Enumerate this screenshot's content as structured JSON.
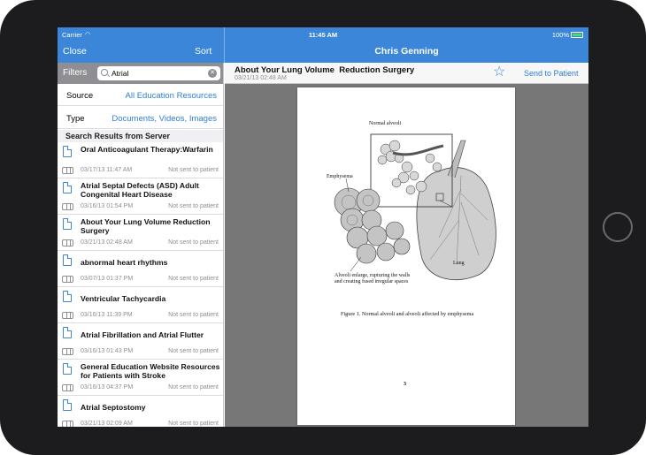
{
  "status_bar": {
    "carrier": "Carrier",
    "time": "11:45 AM",
    "battery": "100%"
  },
  "nav": {
    "close_label": "Close",
    "sort_label": "Sort",
    "title": "Chris Genning"
  },
  "sidebar": {
    "filters_label": "Filters",
    "search": {
      "value": "Atrial",
      "placeholder": ""
    },
    "source_label": "Source",
    "source_value": "All Education Resources",
    "type_label": "Type",
    "type_value": "Documents, Videos, Images",
    "results_header": "Search Results from Server",
    "results": [
      {
        "title": "Oral Anticoagulant Therapy:Warfarin",
        "date": "03/17/13 11:47 AM",
        "status": "Not sent to patient"
      },
      {
        "title": "Atrial Septal Defects (ASD) Adult Congenital Heart Disease",
        "date": "03/16/13 01:54 PM",
        "status": "Not sent to patient"
      },
      {
        "title": "About Your Lung Volume Reduction Surgery",
        "date": "03/21/13 02:48 AM",
        "status": "Not sent to patient"
      },
      {
        "title": "abnormal heart rhythms",
        "date": "03/07/13 01:37 PM",
        "status": "Not sent to patient"
      },
      {
        "title": "Ventricular Tachycardia",
        "date": "03/16/13 11:39 PM",
        "status": "Not sent to patient"
      },
      {
        "title": "Atrial Fibrillation and Atrial Flutter",
        "date": "03/16/13 01:43 PM",
        "status": "Not sent to patient"
      },
      {
        "title": "General Education Website Resources for Patients with Stroke",
        "date": "03/16/13 04:37 PM",
        "status": "Not sent to patient"
      },
      {
        "title": "Atrial Septostomy",
        "date": "03/21/13 02:09 AM",
        "status": "Not sent to patient"
      }
    ]
  },
  "detail": {
    "doc_title": "About Your Lung Volume  Reduction Surgery",
    "doc_date": "03/21/13 02:48 AM",
    "send_label": "Send to Patient",
    "page": {
      "label_normal": "Normal alveoli",
      "label_emphysema": "Emphysema",
      "label_lung": "Lung",
      "label_alveoli": "Alveoli enlarge, rupturing the walls and creating fused irregular spaces",
      "caption": "Figure 1.  Normal alveoli and alveoli affected by emphysema",
      "page_number": "3"
    }
  },
  "colors": {
    "nav_blue": "#3b86d8",
    "link_blue": "#2f7fd6",
    "filter_gray": "#8e8e93",
    "viewer_gray": "#777777"
  },
  "icons": [
    "wifi-icon",
    "battery-icon",
    "search-icon",
    "clear-icon",
    "document-icon",
    "share-icon",
    "star-icon",
    "home-button"
  ]
}
